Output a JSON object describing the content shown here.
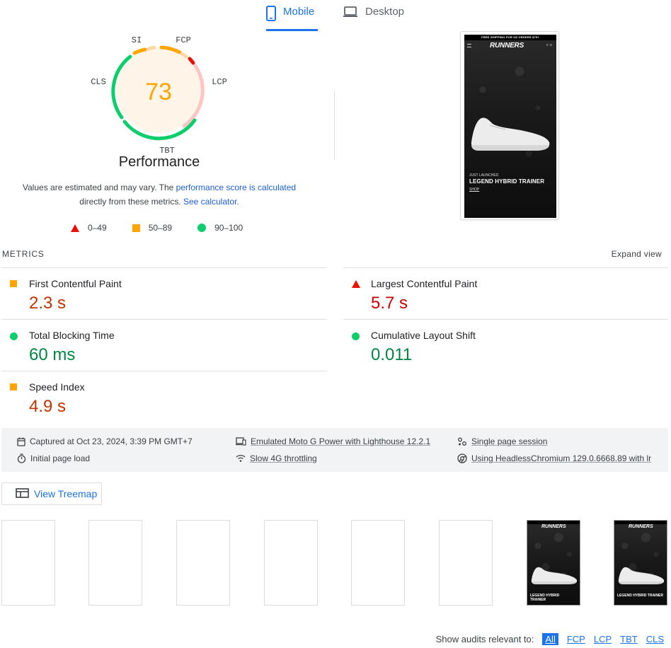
{
  "tabs": [
    {
      "label": "Mobile",
      "active": true
    },
    {
      "label": "Desktop",
      "active": false
    }
  ],
  "gauge": {
    "score": "73",
    "title": "Performance",
    "labels": {
      "si": "SI",
      "fcp": "FCP",
      "lcp": "LCP",
      "tbt": "TBT",
      "cls": "CLS"
    },
    "score_color": "#ffa400"
  },
  "note": {
    "text1": "Values are estimated and may vary. The ",
    "link1": "performance score is calculated",
    "text2": " directly from these metrics. ",
    "link2": "See calculator."
  },
  "legend": [
    {
      "range": "0–49",
      "color": "#eb0f00",
      "shape": "triangle"
    },
    {
      "range": "50–89",
      "color": "#ffa400",
      "shape": "square"
    },
    {
      "range": "90–100",
      "color": "#0cce6b",
      "shape": "circle"
    }
  ],
  "preview": {
    "banner": "FREE SHIPPING FOR US ORDERS $79+",
    "brand": "RUNNERS",
    "kicker": "JUST LAUNCHED",
    "headline": "LEGEND HYBRID TRAINER",
    "cta": "SHOP"
  },
  "metrics": {
    "section_label": "METRICS",
    "expand_label": "Expand view",
    "items": [
      {
        "name": "First Contentful Paint",
        "value": "2.3 s",
        "status": "orange"
      },
      {
        "name": "Largest Contentful Paint",
        "value": "5.7 s",
        "status": "red"
      },
      {
        "name": "Total Blocking Time",
        "value": "60 ms",
        "status": "green"
      },
      {
        "name": "Cumulative Layout Shift",
        "value": "0.011",
        "status": "green"
      },
      {
        "name": "Speed Index",
        "value": "4.9 s",
        "status": "orange"
      }
    ]
  },
  "info": {
    "captured": "Captured at Oct 23, 2024, 3:39 PM GMT+7",
    "initial_load": "Initial page load",
    "emulated": "Emulated Moto G Power with Lighthouse 12.2.1",
    "throttling": "Slow 4G throttling",
    "session": "Single page session",
    "browser": "Using HeadlessChromium 129.0.6668.89 with lr"
  },
  "treemap": {
    "label": "View Treemap"
  },
  "filmstrip": {
    "frame_headline_1": "LEGEND HYBRID\nTRAINER",
    "frame_headline_2": "LEGEND HYBRID TRAINER"
  },
  "filter": {
    "label": "Show audits relevant to:",
    "chips": [
      "All",
      "FCP",
      "LCP",
      "TBT",
      "CLS"
    ]
  }
}
